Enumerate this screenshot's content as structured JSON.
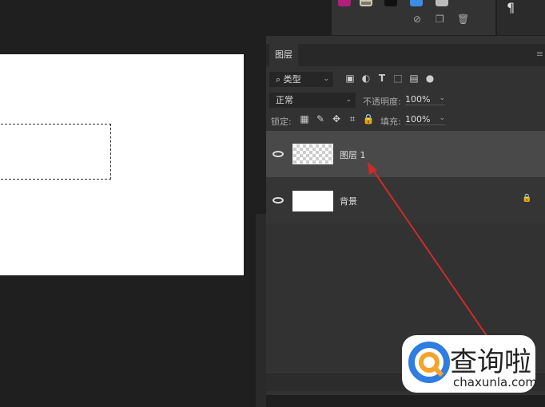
{
  "layers_panel": {
    "tab": "图层",
    "filter_kind": "类型",
    "blend_mode": "正常",
    "opacity_label": "不透明度:",
    "opacity_value": "100%",
    "lock_label": "锁定:",
    "fill_label": "填充:",
    "fill_value": "100%",
    "layers": [
      {
        "name": "图层 1",
        "selected": true
      },
      {
        "name": "背景",
        "locked": true
      }
    ]
  },
  "right_panel": {
    "paragraph_glyph": "¶"
  },
  "watermark": {
    "brand": "查询啦",
    "url": "chaxunla.com"
  },
  "colors": {
    "accent_arrow": "#d02a2a",
    "selected_row": "#494949"
  }
}
